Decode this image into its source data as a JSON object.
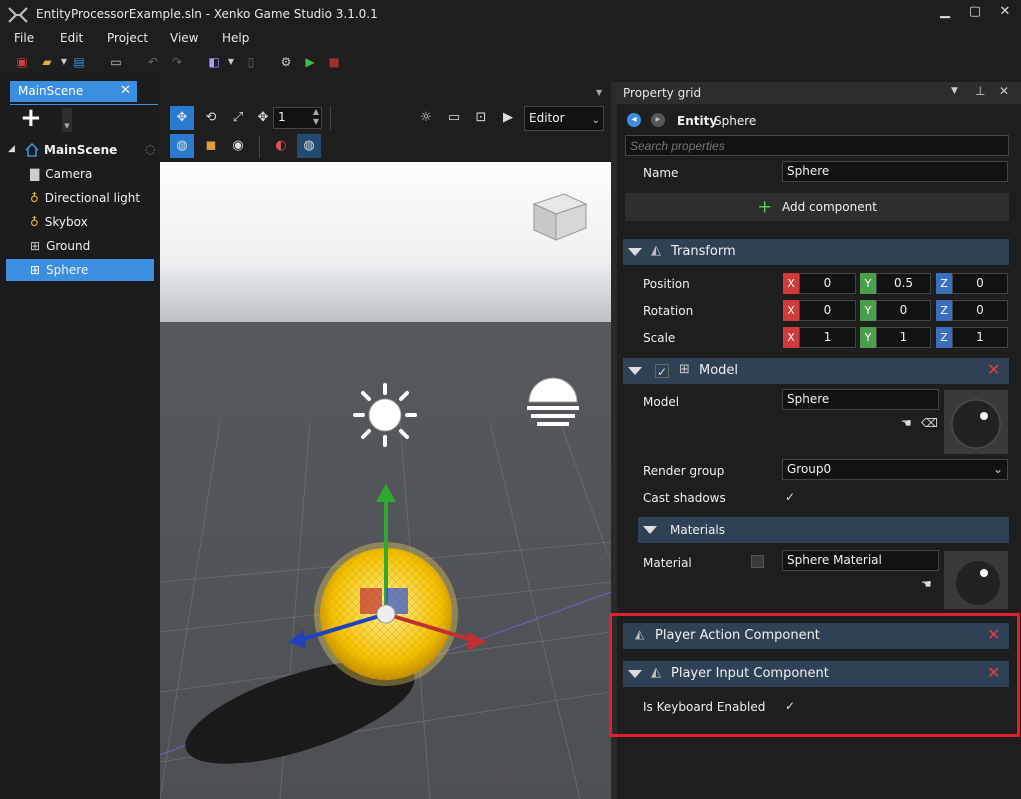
{
  "window": {
    "title": "EntityProcessorExample.sln - Xenko Game Studio 3.1.0.1"
  },
  "menu": [
    "File",
    "Edit",
    "Project",
    "View",
    "Help"
  ],
  "scene_tab": {
    "label": "MainScene"
  },
  "scene_tree": {
    "root": "MainScene",
    "items": [
      {
        "label": "Camera"
      },
      {
        "label": "Directional light"
      },
      {
        "label": "Skybox"
      },
      {
        "label": "Ground"
      },
      {
        "label": "Sphere"
      }
    ]
  },
  "viewport": {
    "snap_value": "1",
    "camera_mode": "Editor"
  },
  "property_grid": {
    "title": "Property grid",
    "entity_prefix": "Entity",
    "entity_name": "Sphere",
    "search_placeholder": "Search properties",
    "name_label": "Name",
    "name_value": "Sphere",
    "add_component": "Add component",
    "transform": {
      "title": "Transform",
      "rows": [
        {
          "label": "Position",
          "x": "0",
          "y": "0.5",
          "z": "0"
        },
        {
          "label": "Rotation",
          "x": "0",
          "y": "0",
          "z": "0"
        },
        {
          "label": "Scale",
          "x": "1",
          "y": "1",
          "z": "1"
        }
      ]
    },
    "model": {
      "title": "Model",
      "model_label": "Model",
      "model_value": "Sphere",
      "render_group_label": "Render group",
      "render_group_value": "Group0",
      "cast_shadows_label": "Cast shadows",
      "materials_title": "Materials",
      "material_label": "Material",
      "material_value": "Sphere Material"
    },
    "player_action": {
      "title": "Player Action Component"
    },
    "player_input": {
      "title": "Player Input Component",
      "keyboard_label": "Is Keyboard Enabled"
    }
  },
  "colors": {
    "accent": "#3c8ee0",
    "highlight": "#e0202a",
    "section": "#2f4255"
  }
}
